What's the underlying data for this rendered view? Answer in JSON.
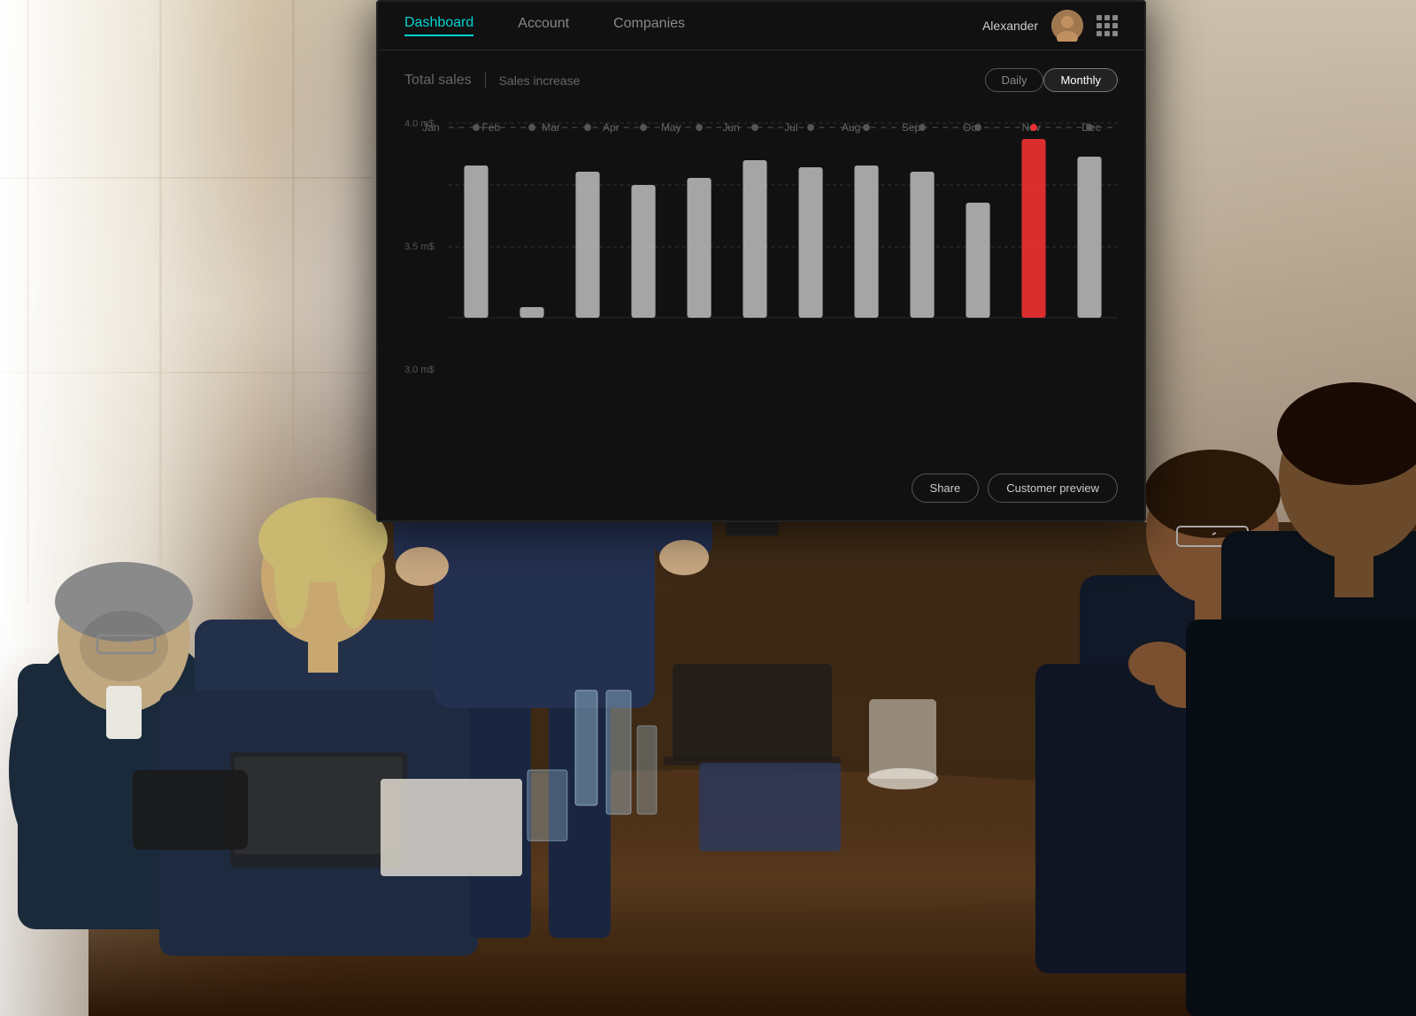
{
  "nav": {
    "tabs": [
      {
        "label": "Dashboard",
        "active": true
      },
      {
        "label": "Account",
        "active": false
      },
      {
        "label": "Companies",
        "active": false
      }
    ],
    "username": "Alexander",
    "grid_icon_label": "grid-icon"
  },
  "chart": {
    "title": "Total sales",
    "subtitle": "Sales increase",
    "toggle_daily": "Daily",
    "toggle_monthly": "Monthly",
    "y_labels": [
      "4.0 m$",
      "3.5 m$",
      "3.0 m$"
    ],
    "months": [
      "Jan",
      "Feb",
      "Mar",
      "Apr",
      "May",
      "Jun",
      "Jul",
      "Aug",
      "Sep",
      "Oct",
      "Nov",
      "Dec"
    ],
    "bars": [
      {
        "month": "Jan",
        "height": 0.72,
        "highlighted": false
      },
      {
        "month": "Feb",
        "height": 0.0,
        "highlighted": false
      },
      {
        "month": "Mar",
        "height": 0.68,
        "highlighted": false
      },
      {
        "month": "Apr",
        "height": 0.6,
        "highlighted": false
      },
      {
        "month": "May",
        "height": 0.65,
        "highlighted": false
      },
      {
        "month": "Jun",
        "height": 0.75,
        "highlighted": false
      },
      {
        "month": "Jul",
        "height": 0.7,
        "highlighted": false
      },
      {
        "month": "Aug",
        "height": 0.72,
        "highlighted": false
      },
      {
        "month": "Sep",
        "height": 0.68,
        "highlighted": false
      },
      {
        "month": "Oct",
        "height": 0.55,
        "highlighted": false
      },
      {
        "month": "Nov",
        "height": 0.88,
        "highlighted": true
      },
      {
        "month": "Dec",
        "height": 0.78,
        "highlighted": false
      }
    ],
    "bottom_btn1": "Share",
    "bottom_btn2": "Customer preview"
  },
  "accent_color": "#00d4d4",
  "highlight_color": "#e63030"
}
